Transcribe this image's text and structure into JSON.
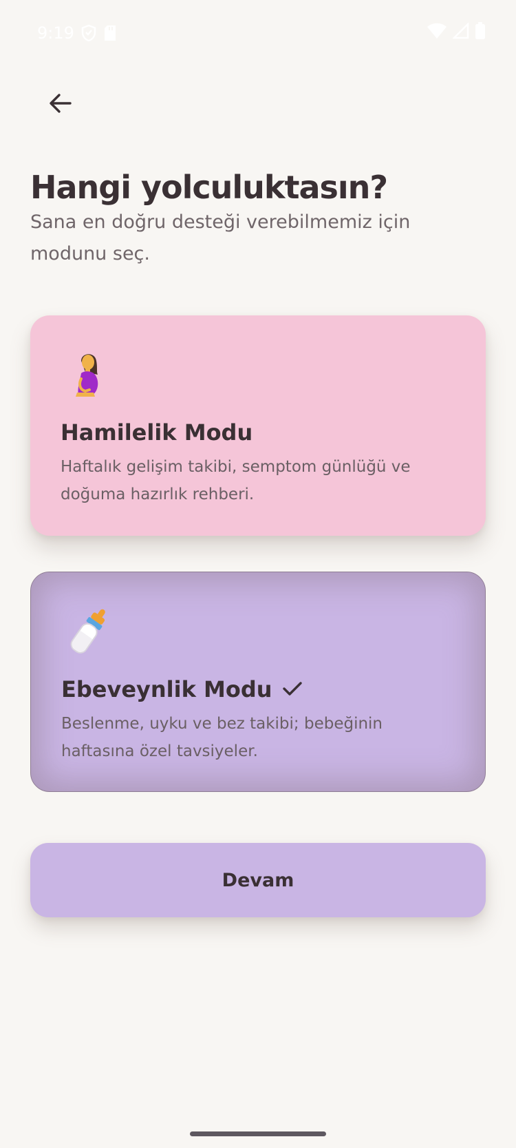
{
  "status_bar": {
    "time": "9:19",
    "left_icons": [
      "shield-icon",
      "sd-card-icon"
    ],
    "right_icons": [
      "wifi-icon",
      "cellular-signal-icon",
      "battery-icon"
    ]
  },
  "header": {
    "back_icon": "arrow-left-icon",
    "title": "Hangi yolculuktasın?",
    "subtitle": "Sana en doğru desteği verebilmemiz için modunu seç."
  },
  "modes": [
    {
      "icon": "pregnant-woman-icon",
      "title": "Hamilelik Modu",
      "description": "Haftalık gelişim takibi, semptom günlüğü ve doğuma hazırlık rehberi.",
      "selected": false,
      "color": "#F5C5D8"
    },
    {
      "icon": "baby-bottle-icon",
      "title": "Ebeveynlik Modu",
      "description": "Beslenme, uyku ve bez takibi; bebeğinin haftasına özel tavsiyeler.",
      "selected": true,
      "selected_icon": "checkmark-icon",
      "color": "#C9B5E4"
    }
  ],
  "actions": {
    "continue_label": "Devam"
  },
  "colors": {
    "background": "#F8F6F3",
    "text_primary": "#3A3034",
    "text_secondary": "#6F6569",
    "accent": "#C9B5E4"
  }
}
